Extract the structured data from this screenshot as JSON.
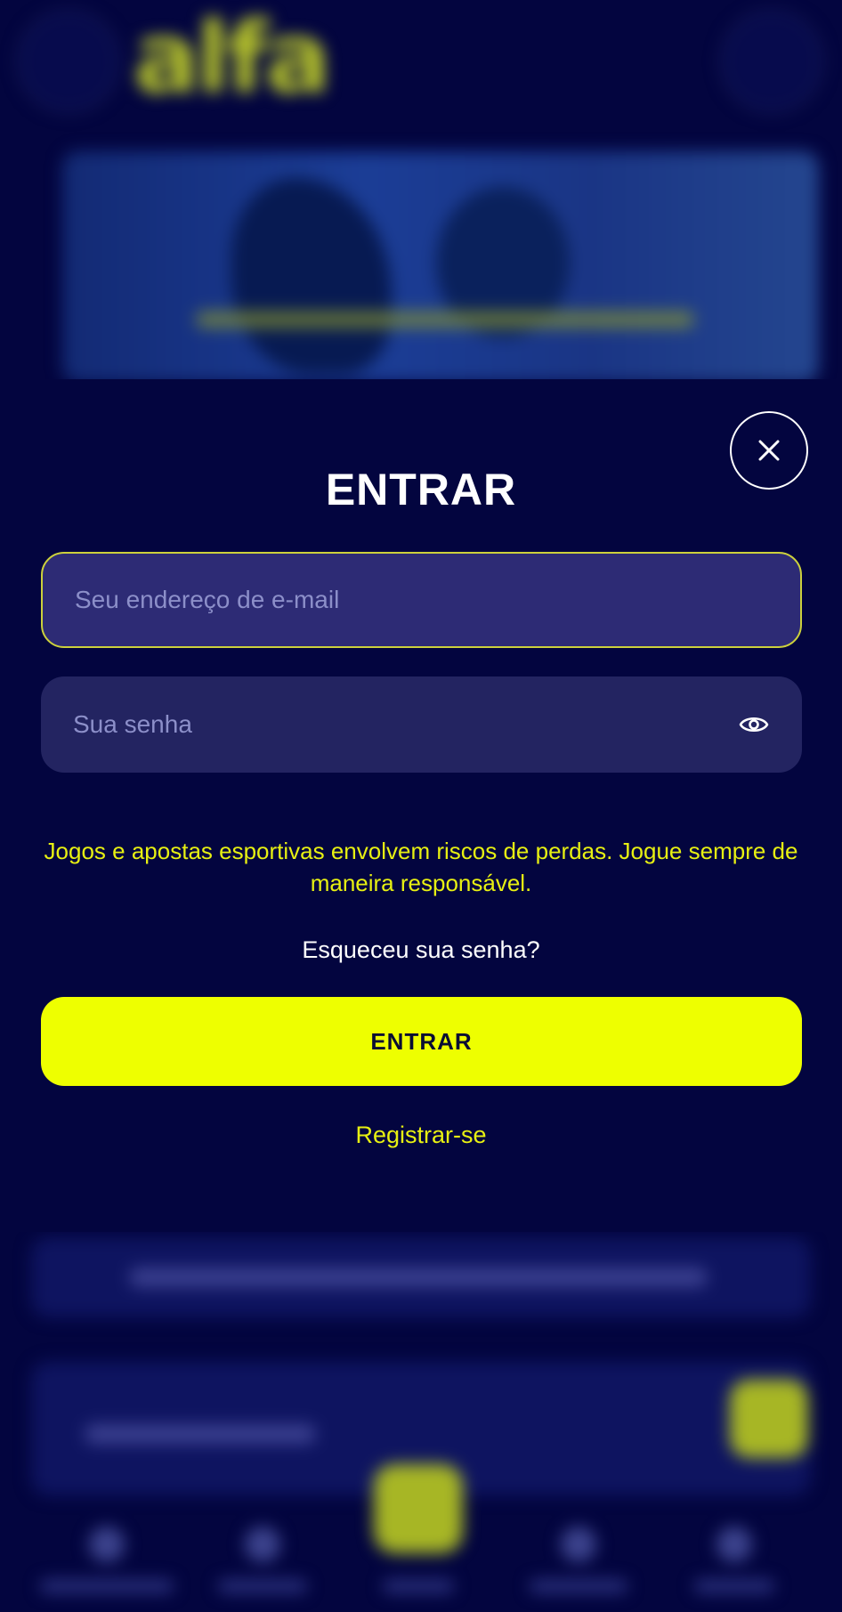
{
  "colors": {
    "background": "#03053f",
    "accent": "#eeff00",
    "input_background": "#232461",
    "input_focus_border": "#ccd13c",
    "warning_text": "#e7f012"
  },
  "background_app": {
    "logo_text": "alfa",
    "state": "blurred"
  },
  "login": {
    "title": "ENTRAR",
    "close_icon": "close-icon",
    "email_placeholder": "Seu endereço de e-mail",
    "password_placeholder": "Sua senha",
    "password_toggle_icon": "eye-icon",
    "warning_text": "Jogos e apostas esportivas envolvem riscos de perdas. Jogue sempre de maneira responsável.",
    "forgot_password": "Esqueceu sua senha?",
    "submit_label": "ENTRAR",
    "register_link": "Registrar-se"
  }
}
